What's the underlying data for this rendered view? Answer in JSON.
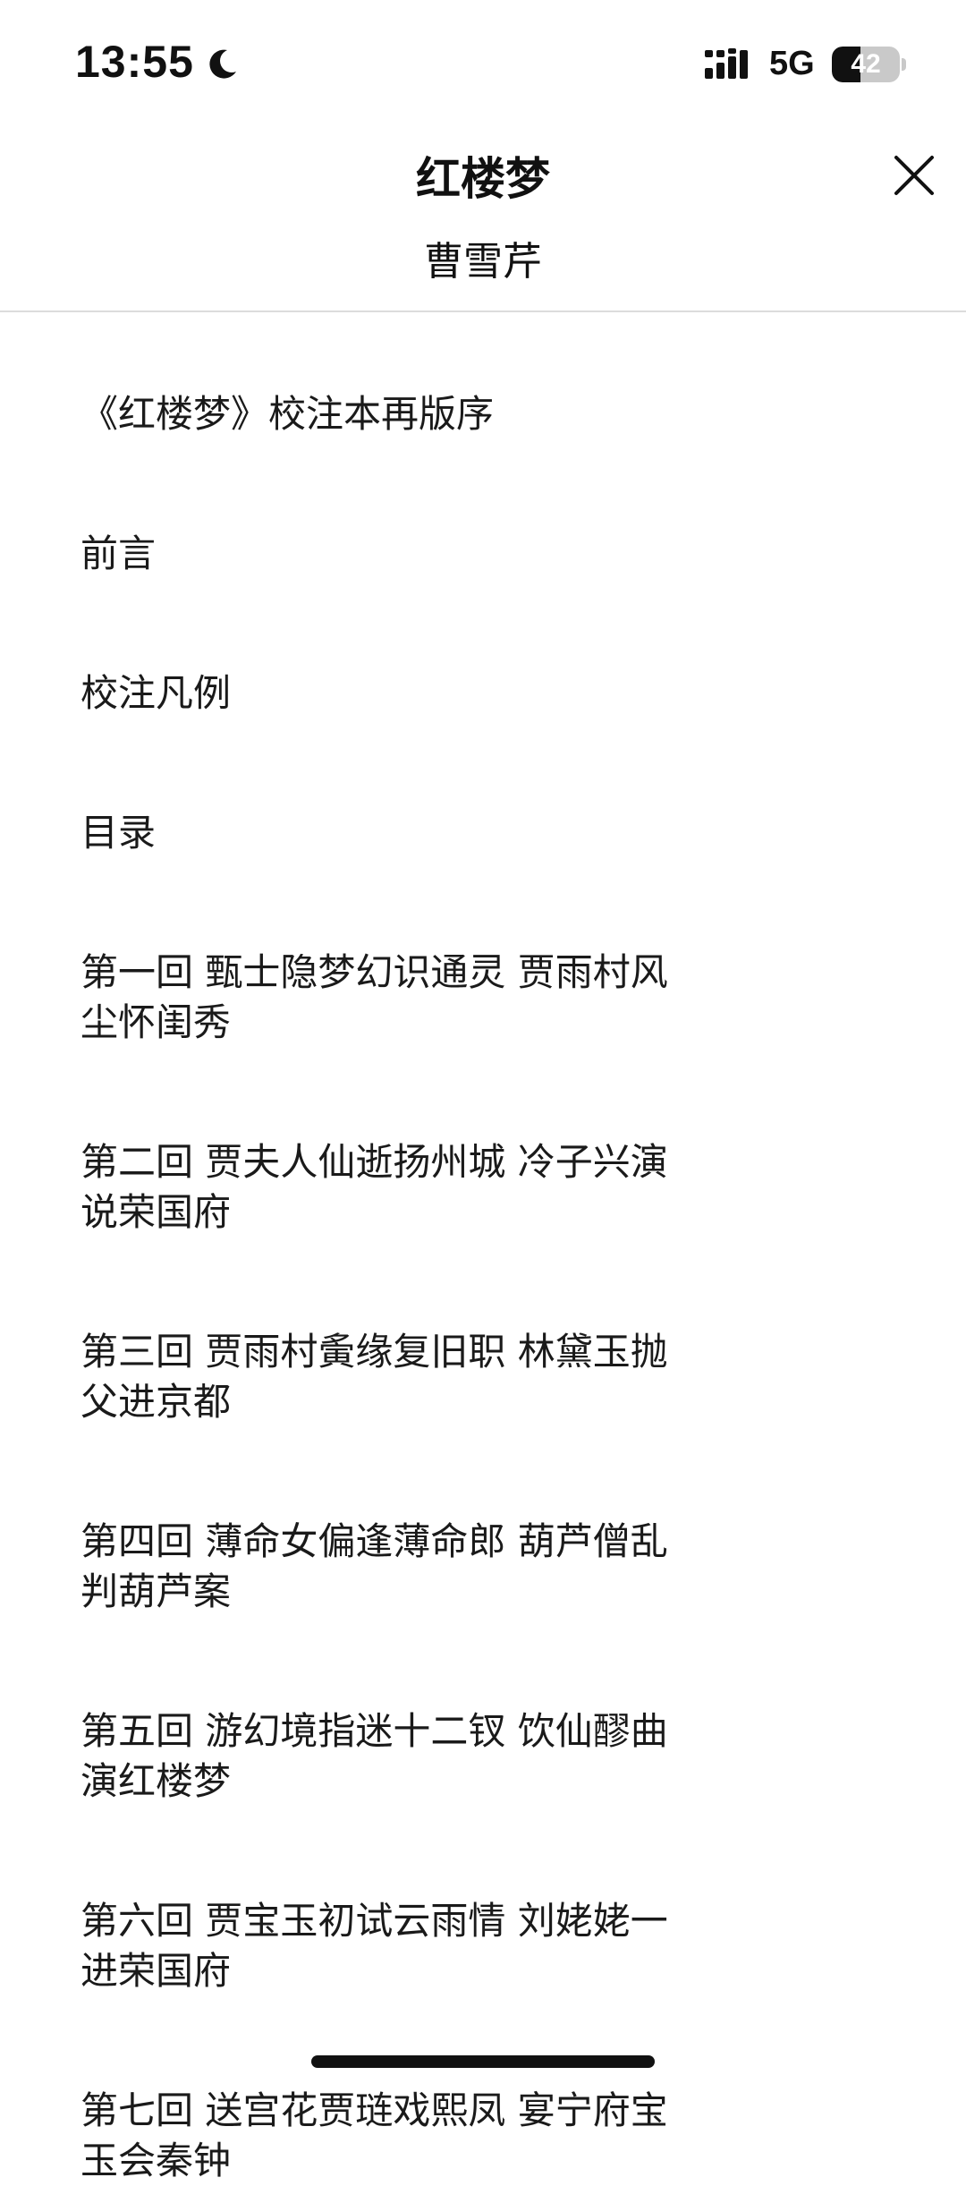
{
  "status_bar": {
    "time": "13:55",
    "network": "5G",
    "battery": "42",
    "battery_level": 0.42,
    "icons": [
      "moon-icon",
      "signal-icon",
      "battery-icon"
    ]
  },
  "header": {
    "title": "红楼梦",
    "author": "曹雪芹",
    "close_icon": "close-icon"
  },
  "toc": {
    "items": [
      "《红楼梦》校注本再版序",
      "前言",
      "校注凡例",
      "目录",
      "第一回 甄士隐梦幻识通灵 贾雨村风尘怀闺秀",
      "第二回 贾夫人仙逝扬州城 冷子兴演说荣国府",
      "第三回 贾雨村夤缘复旧职 林黛玉抛父进京都",
      "第四回 薄命女偏逢薄命郎 葫芦僧乱判葫芦案",
      "第五回 游幻境指迷十二钗 饮仙醪曲演红楼梦",
      "第六回 贾宝玉初试云雨情 刘姥姥一进荣国府",
      "第七回 送宫花贾琏戏熙凤 宴宁府宝玉会秦钟"
    ]
  }
}
